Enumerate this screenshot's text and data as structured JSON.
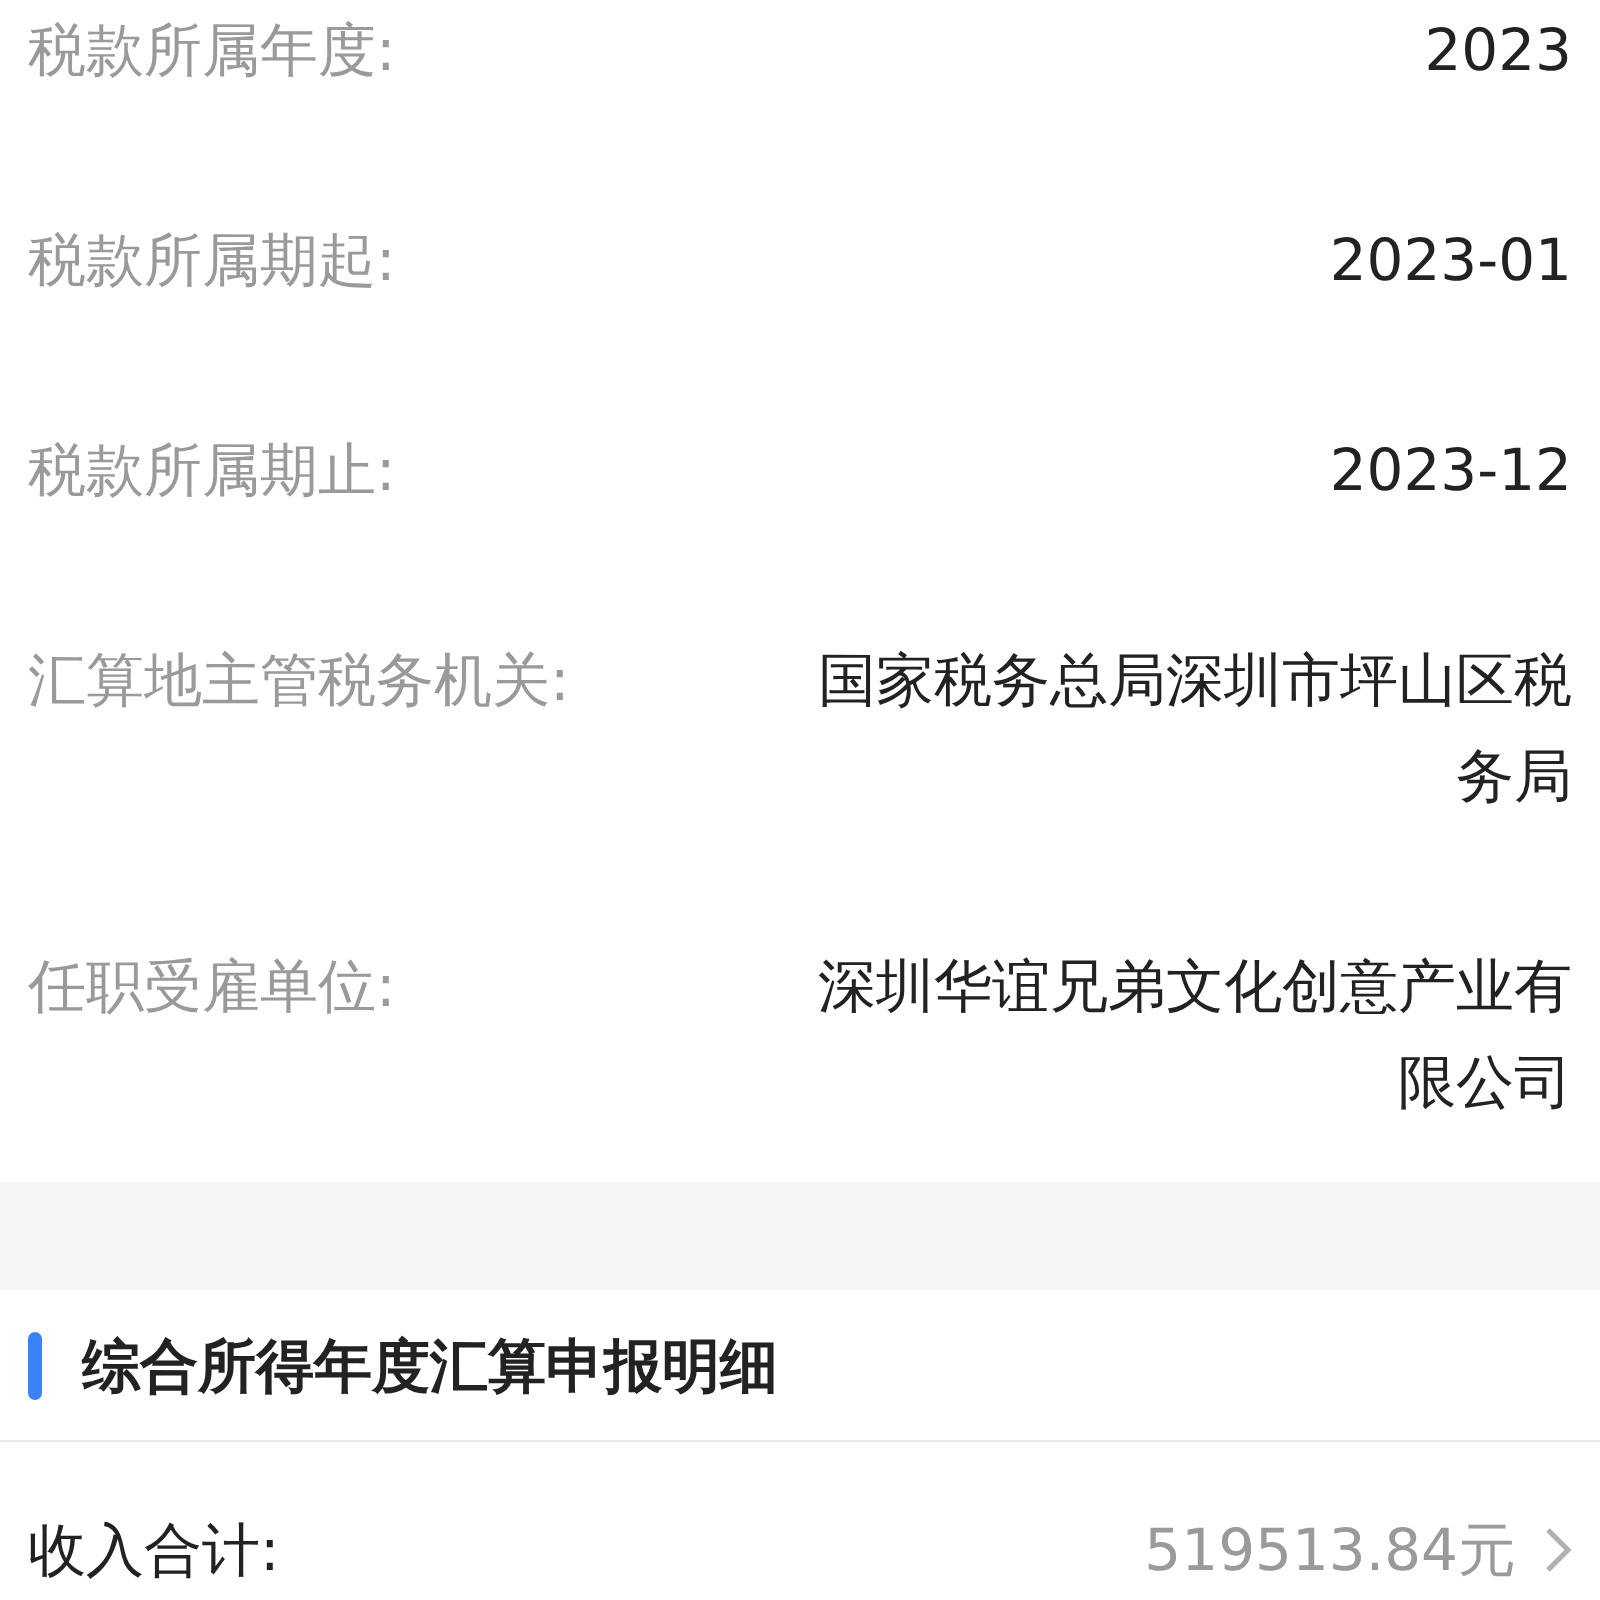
{
  "details": [
    {
      "label": "税款所属年度:",
      "value": "2023"
    },
    {
      "label": "税款所属期起:",
      "value": "2023-01"
    },
    {
      "label": "税款所属期止:",
      "value": "2023-12"
    },
    {
      "label": "汇算地主管税务机关:",
      "value": "国家税务总局深圳市坪山区税务局"
    },
    {
      "label": "任职受雇单位:",
      "value": "深圳华谊兄弟文化创意产业有限公司"
    }
  ],
  "section": {
    "title": "综合所得年度汇算申报明细"
  },
  "summary": [
    {
      "label": "收入合计:",
      "value": "519513.84元"
    }
  ]
}
